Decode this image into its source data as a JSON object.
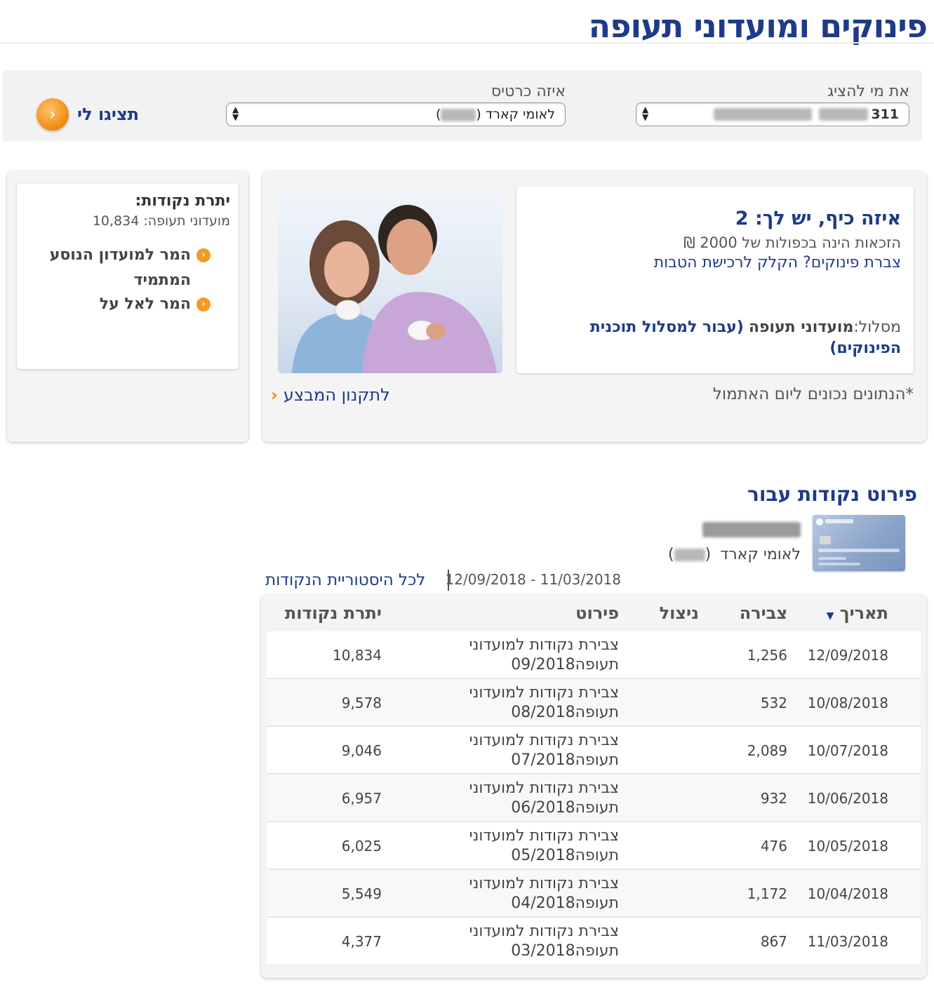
{
  "page": {
    "title": "פינוקים ומועדוני תעופה"
  },
  "filters": {
    "who_label": "את מי להציג",
    "who_value": "311",
    "card_label": "איזה כרטיס",
    "card_value": "לאומי קארד",
    "show_button": "תציגו לי"
  },
  "balance": {
    "title": "יתרת נקודות:",
    "line": "מועדוני תעופה: 10,834",
    "links": [
      "המר למועדון הנוסע המתמיד",
      "המר לאל על"
    ]
  },
  "promo": {
    "heading": "איזה כיף, יש לך: 2",
    "text": "הזכאות הינה בכפולות של 2000 ₪",
    "link": "צברת פינוקים? הקלק לרכישת הטבות",
    "track_prefix": "מסלול:",
    "track_name": "מועדוני תעופה",
    "track_link": "(עבור למסלול תוכנית הפינוקים)",
    "note": "*הנתונים נכונים ליום האתמול",
    "regs_link": "לתקנון המבצע"
  },
  "details": {
    "title": "פירוט נקודות עבור",
    "card_name": "לאומי קארד",
    "date_range": "11/03/2018 - 12/09/2018",
    "history_link": "לכל היסטוריית הנקודות",
    "columns": {
      "date": "תאריך",
      "earn": "צבירה",
      "use": "ניצול",
      "desc": "פירוט",
      "balance": "יתרת נקודות"
    },
    "rows": [
      {
        "date": "12/09/2018",
        "earn": "1,256",
        "use": "",
        "desc": "צבירת נקודות למועדוני תעופה09/2018",
        "balance": "10,834"
      },
      {
        "date": "10/08/2018",
        "earn": "532",
        "use": "",
        "desc": "צבירת נקודות למועדוני תעופה08/2018",
        "balance": "9,578"
      },
      {
        "date": "10/07/2018",
        "earn": "2,089",
        "use": "",
        "desc": "צבירת נקודות למועדוני תעופה07/2018",
        "balance": "9,046"
      },
      {
        "date": "10/06/2018",
        "earn": "932",
        "use": "",
        "desc": "צבירת נקודות למועדוני תעופה06/2018",
        "balance": "6,957"
      },
      {
        "date": "10/05/2018",
        "earn": "476",
        "use": "",
        "desc": "צבירת נקודות למועדוני תעופה05/2018",
        "balance": "6,025"
      },
      {
        "date": "10/04/2018",
        "earn": "1,172",
        "use": "",
        "desc": "צבירת נקודות למועדוני תעופה04/2018",
        "balance": "5,549"
      },
      {
        "date": "11/03/2018",
        "earn": "867",
        "use": "",
        "desc": "צבירת נקודות למועדוני תעופה03/2018",
        "balance": "4,377"
      }
    ]
  },
  "colors": {
    "brand_blue": "#1f3a8a",
    "accent_orange": "#f08a10"
  }
}
